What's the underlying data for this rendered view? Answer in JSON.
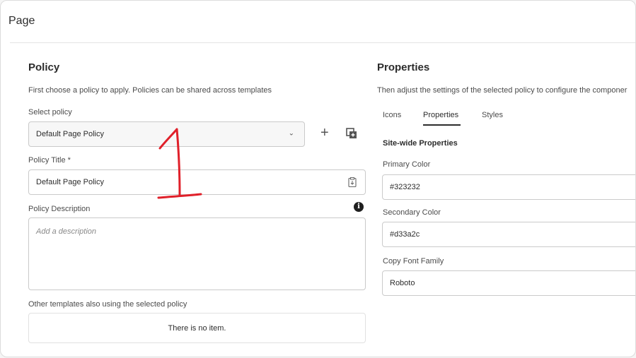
{
  "dialog": {
    "title": "Page"
  },
  "policy": {
    "heading": "Policy",
    "description": "First choose a policy to apply. Policies can be shared across templates",
    "select_label": "Select policy",
    "selected_policy": "Default Page Policy",
    "title_label": "Policy Title *",
    "title_value": "Default Page Policy",
    "description_label": "Policy Description",
    "description_placeholder": "Add a description",
    "other_templates_label": "Other templates also using the selected policy",
    "empty_message": "There is no item."
  },
  "properties": {
    "heading": "Properties",
    "description": "Then adjust the settings of the selected policy to configure the componer",
    "tabs": [
      {
        "label": "Icons"
      },
      {
        "label": "Properties",
        "active": true
      },
      {
        "label": "Styles"
      }
    ],
    "section_title": "Site-wide Properties",
    "fields": [
      {
        "label": "Primary Color",
        "value": "#323232"
      },
      {
        "label": "Secondary Color",
        "value": "#d33a2c"
      },
      {
        "label": "Copy Font Family",
        "value": "Roboto"
      }
    ]
  },
  "icons": {
    "add": "plus-icon",
    "copy": "copy-icon",
    "clipboard": "clipboard-icon",
    "info": "info-icon",
    "dropdown": "chevron-down-icon"
  },
  "annotation_color": "#e0202a"
}
